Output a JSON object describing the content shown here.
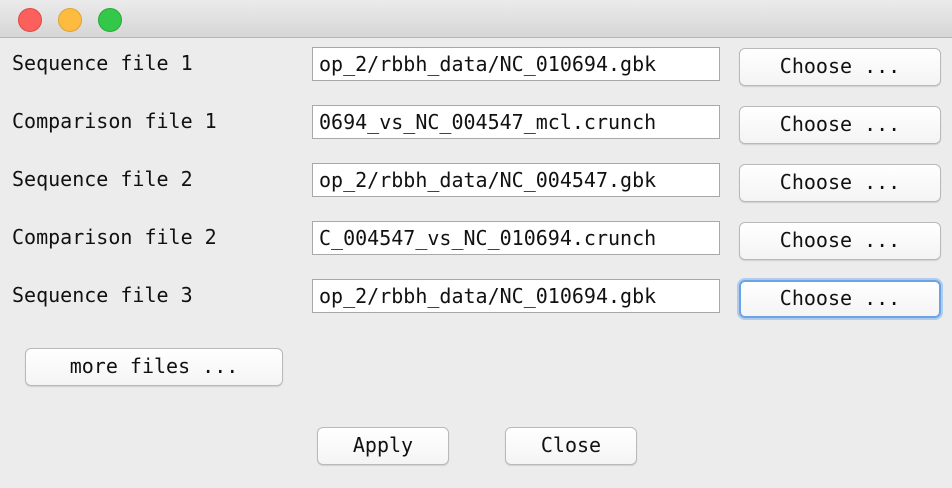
{
  "window": {
    "traffic_lights": [
      "close",
      "minimize",
      "maximize"
    ]
  },
  "rows": [
    {
      "label": "Sequence file 1",
      "value": "op_2/rbbh_data/NC_010694.gbk",
      "button": "Choose ..."
    },
    {
      "label": "Comparison file 1",
      "value": "0694_vs_NC_004547_mcl.crunch",
      "button": "Choose ..."
    },
    {
      "label": "Sequence file 2",
      "value": "op_2/rbbh_data/NC_004547.gbk",
      "button": "Choose ..."
    },
    {
      "label": "Comparison file 2",
      "value": "C_004547_vs_NC_010694.crunch",
      "button": "Choose ..."
    },
    {
      "label": "Sequence file 3",
      "value": "op_2/rbbh_data/NC_010694.gbk",
      "button": "Choose ..."
    }
  ],
  "more_files_label": "more files ...",
  "apply_label": "Apply",
  "close_label": "Close",
  "colors": {
    "window_bg": "#ececec",
    "close_light": "#fc605c",
    "minimize_light": "#fdbc40",
    "maximize_light": "#34c84a",
    "focus_ring": "#6aa3e8"
  }
}
